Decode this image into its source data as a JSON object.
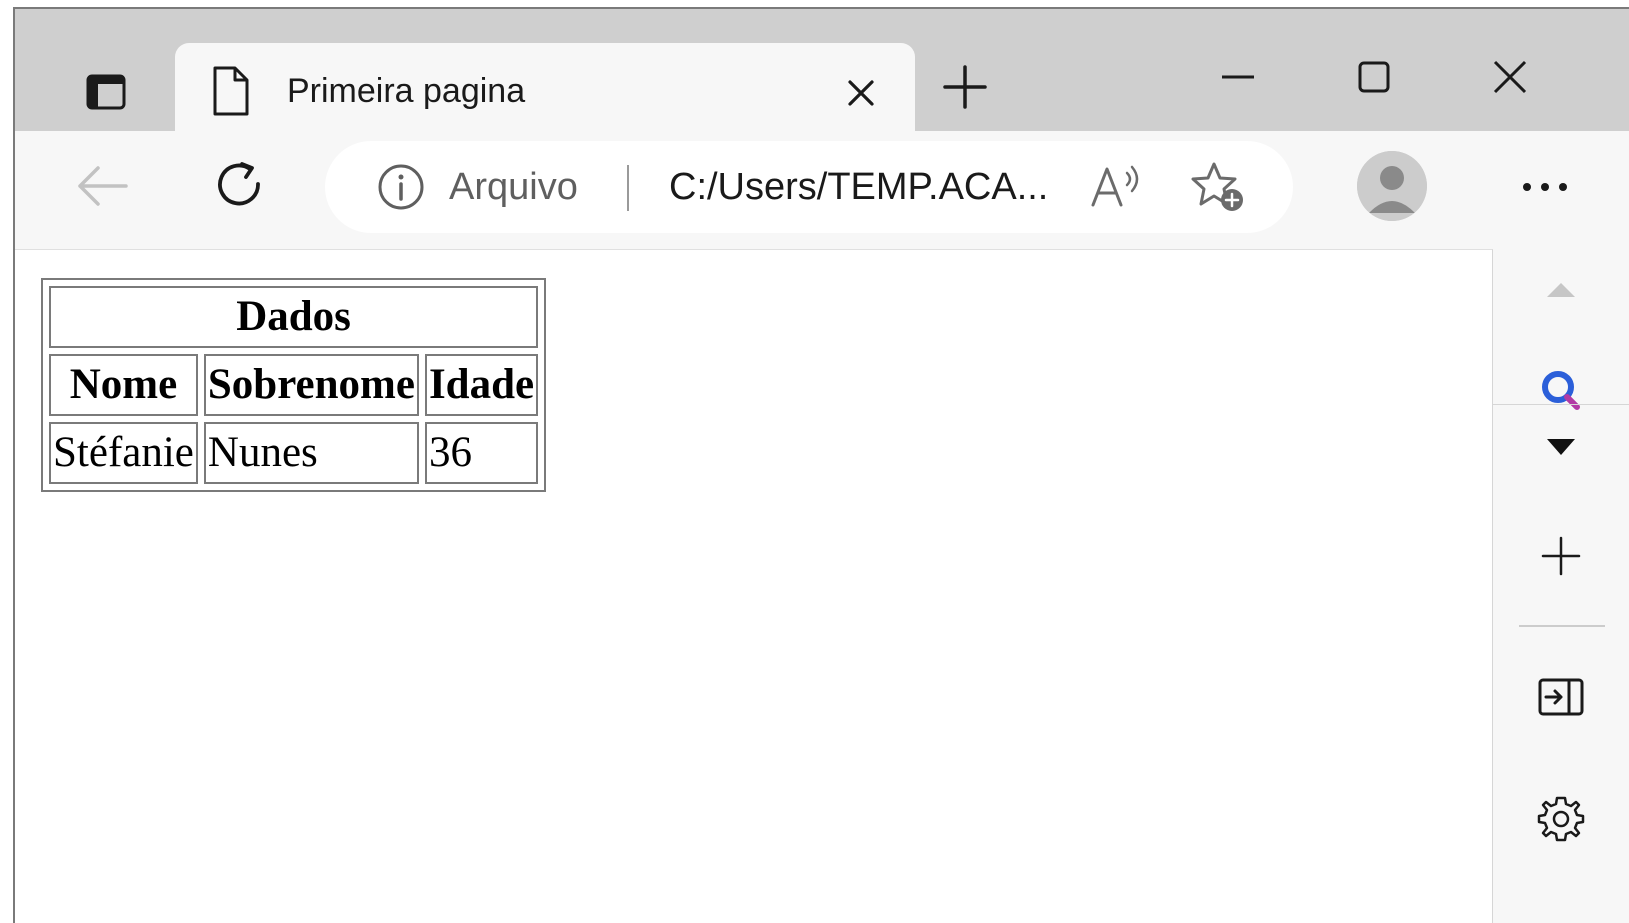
{
  "browser": {
    "tab": {
      "title": "Primeira pagina"
    },
    "address_bar": {
      "site_label": "Arquivo",
      "url": "C:/Users/TEMP.ACA..."
    },
    "icons": {
      "tab_actions": "tab-actions-icon",
      "tab_page": "page-icon",
      "tab_close": "close-icon",
      "new_tab": "plus-icon",
      "minimize": "minimize-icon",
      "maximize": "maximize-icon",
      "close_window": "close-icon",
      "back": "arrow-left-icon",
      "refresh": "refresh-icon",
      "site_info": "info-icon",
      "read_aloud": "read-aloud-icon",
      "add_favorite": "star-plus-icon",
      "profile": "avatar-icon",
      "more": "ellipsis-icon"
    }
  },
  "page": {
    "table": {
      "caption_header": "Dados",
      "columns": [
        "Nome",
        "Sobrenome",
        "Idade"
      ],
      "rows": [
        [
          "Stéfanie",
          "Nunes",
          "36"
        ]
      ]
    }
  },
  "sidebar": {
    "icons": [
      "chevron-up-icon",
      "search-icon",
      "chevron-down-icon",
      "plus-icon",
      "sidebar-toggle-icon",
      "gear-icon"
    ]
  }
}
